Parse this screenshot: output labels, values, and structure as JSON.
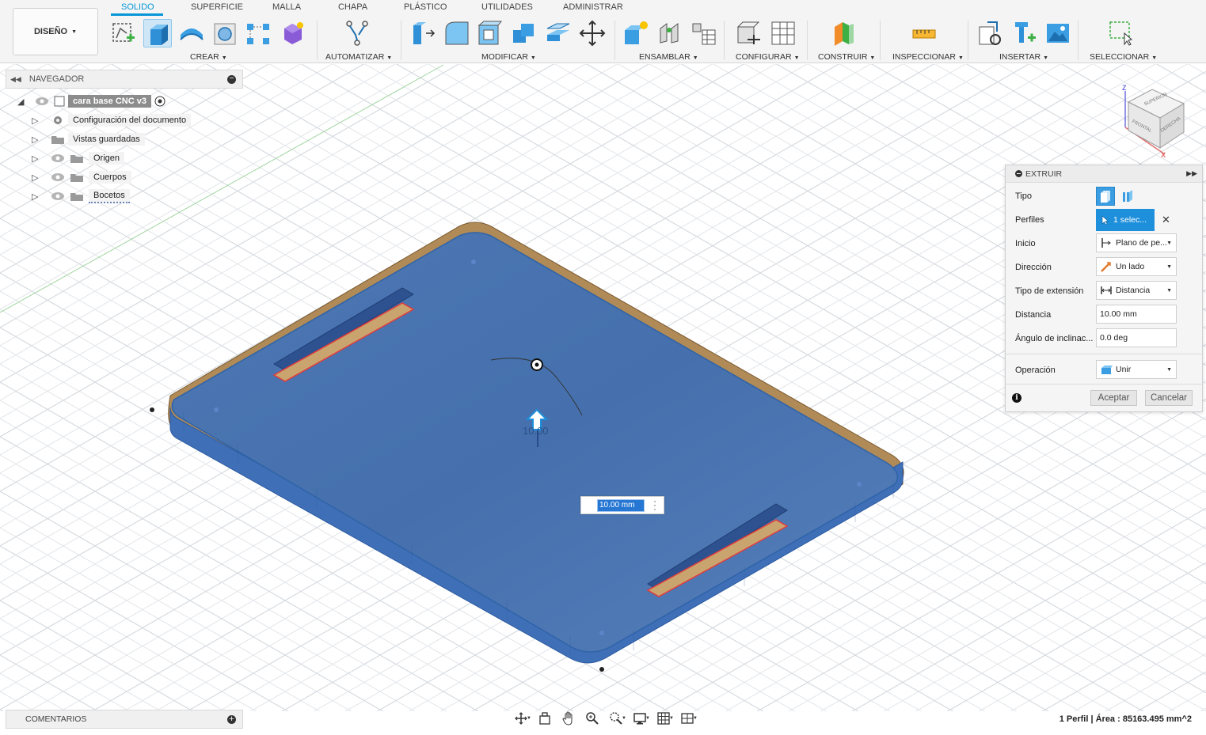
{
  "toolbar": {
    "workspace": "DISEÑO",
    "tabs": [
      "SOLIDO",
      "SUPERFICIE",
      "MALLA",
      "CHAPA",
      "PLÁSTICO",
      "UTILIDADES",
      "ADMINISTRAR"
    ],
    "active_tab": "SOLIDO",
    "groups": [
      "CREAR",
      "AUTOMATIZAR",
      "MODIFICAR",
      "ENSAMBLAR",
      "CONFIGURAR",
      "CONSTRUIR",
      "INSPECCIONAR",
      "INSERTAR",
      "SELECCIONAR"
    ],
    "accent": "#0696d7"
  },
  "navigator": {
    "title": "NAVEGADOR",
    "root": "cara base CNC v3",
    "items": [
      {
        "label": "Configuración del documento",
        "icon": "gear-icon"
      },
      {
        "label": "Vistas guardadas",
        "icon": "folder-icon"
      },
      {
        "label": "Origen",
        "icon": "folder-icon"
      },
      {
        "label": "Cuerpos",
        "icon": "folder-icon"
      },
      {
        "label": "Bocetos",
        "icon": "folder-icon"
      }
    ]
  },
  "viewcube": {
    "top": "SUPERIOR",
    "front": "FRONTAL",
    "right": "DERECHA",
    "axis_z": "Z",
    "axis_x": "X"
  },
  "extrude": {
    "title": "EXTRUIR",
    "labels": {
      "type": "Tipo",
      "profiles": "Perfiles",
      "start": "Inicio",
      "direction": "Dirección",
      "extent_type": "Tipo de extensión",
      "distance": "Distancia",
      "taper": "Ángulo de inclinac...",
      "operation": "Operación"
    },
    "values": {
      "profiles": "1 selec...",
      "start": "Plano de pe...",
      "direction": "Un lado",
      "extent_type": "Distancia",
      "distance": "10.00 mm",
      "taper": "0.0 deg",
      "operation": "Unir"
    },
    "buttons": {
      "ok": "Aceptar",
      "cancel": "Cancelar"
    }
  },
  "dimension_input": "10.00 mm",
  "manipulator_label": "10.00",
  "comments": "COMENTARIOS",
  "status": "1 Perfil | Área : 85163.495 mm^2"
}
